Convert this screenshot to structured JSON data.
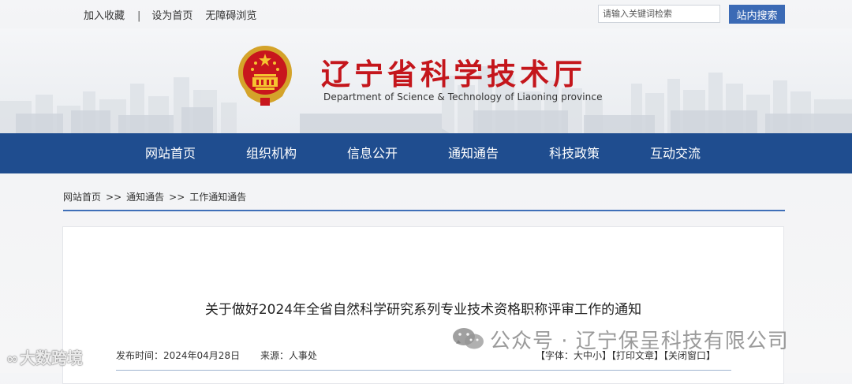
{
  "topbar": {
    "links": [
      "加入收藏",
      "设为首页",
      "无障碍浏览"
    ],
    "separator": "|",
    "search": {
      "placeholder": "请输入关键词检索",
      "button": "站内搜索"
    }
  },
  "header": {
    "title": "辽宁省科学技术厅",
    "subtitle": "Department of Science & Technology of Liaoning province"
  },
  "nav": {
    "items": [
      "网站首页",
      "组织机构",
      "信息公开",
      "通知通告",
      "科技政策",
      "互动交流"
    ]
  },
  "breadcrumb": {
    "items": [
      "网站首页",
      "通知通告",
      "工作通知通告"
    ],
    "separator": ">>"
  },
  "article": {
    "title": "关于做好2024年全省自然科学研究系列专业技术资格职称评审工作的通知",
    "date": "发布时间：2024年04月28日",
    "source": "来源：人事处",
    "tools": [
      "【字体：大中小】",
      "【打印文章】",
      "【关闭窗口】"
    ]
  },
  "watermarks": {
    "left": "大数跨境",
    "right": "公众号 · 辽宁保呈科技有限公司"
  },
  "colors": {
    "nav_bg": "#1f4d8f",
    "title_red": "#c4161c",
    "button_blue": "#3b6ab5",
    "rule_blue": "#3f6fb8"
  },
  "icons": {
    "emblem": "national-emblem-icon",
    "wechat": "wechat-icon",
    "watermark_loop": "loop-logo-icon"
  }
}
